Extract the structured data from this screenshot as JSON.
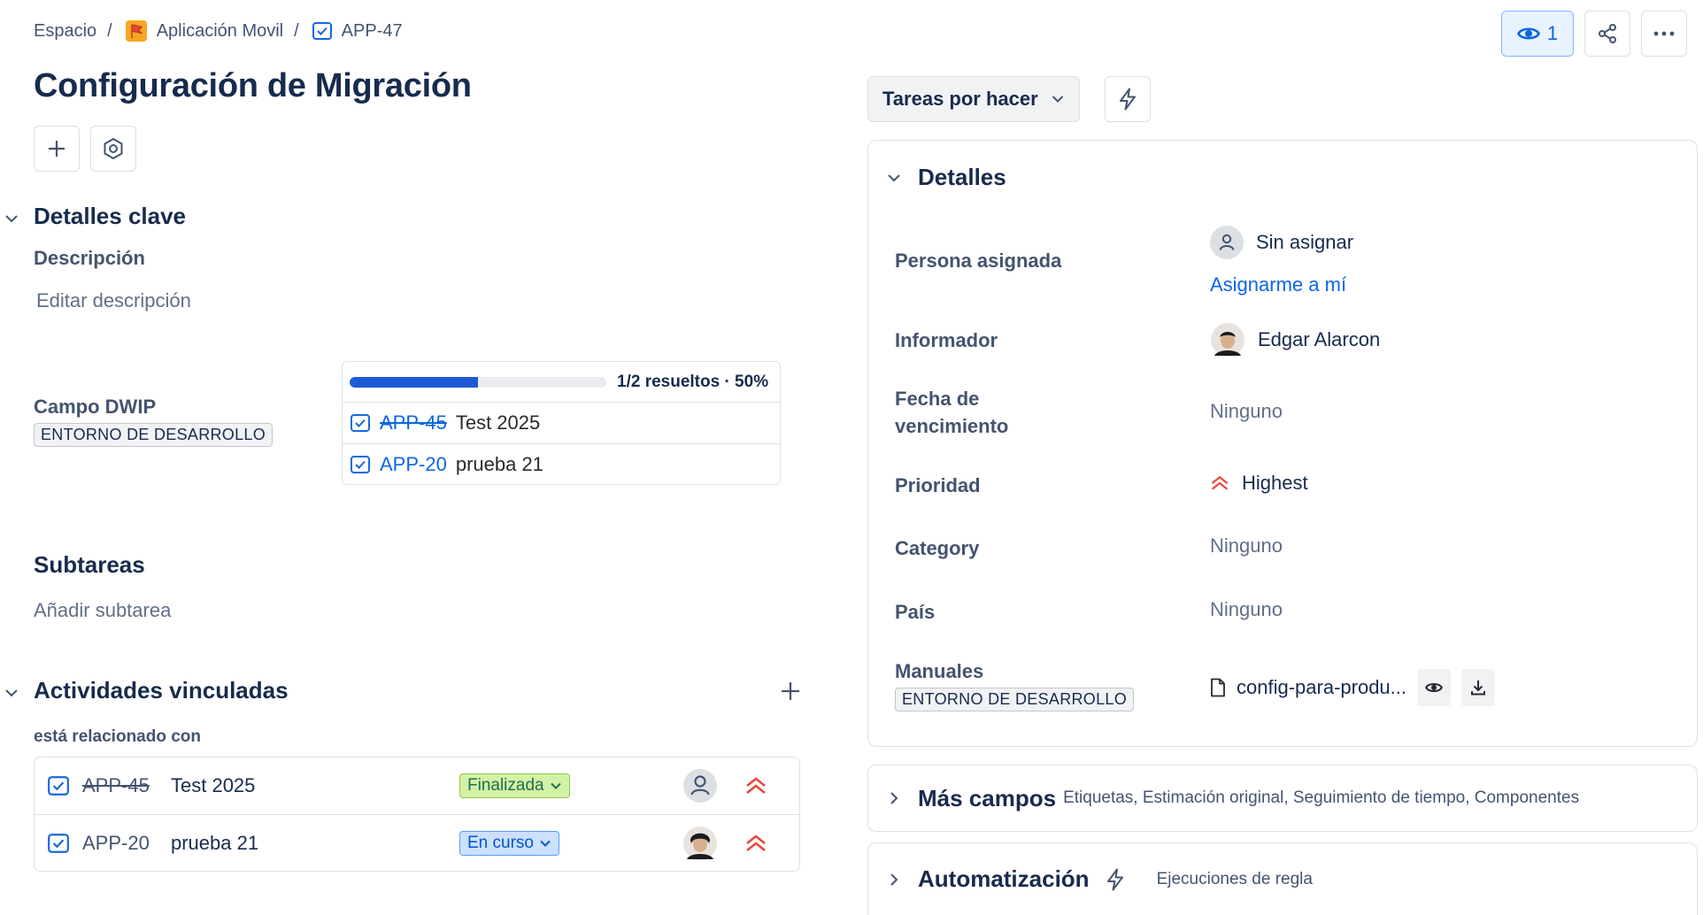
{
  "breadcrumb": {
    "space": "Espacio",
    "project": "Aplicación Movil",
    "issue_key": "APP-47",
    "separator": "/"
  },
  "header": {
    "watch_count": "1",
    "title": "Configuración de Migración"
  },
  "key_details": {
    "heading": "Detalles clave",
    "description_label": "Descripción",
    "description_placeholder": "Editar descripción",
    "dwip": {
      "label": "Campo DWIP",
      "environment": "ENTORNO DE DESARROLLO",
      "progress_text": "1/2 resueltos · 50%",
      "progress_fraction": 0.5,
      "items": [
        {
          "key": "APP-45",
          "summary": "Test 2025",
          "resolved": true
        },
        {
          "key": "APP-20",
          "summary": "prueba 21",
          "resolved": false
        }
      ]
    }
  },
  "subtasks": {
    "heading": "Subtareas",
    "add_label": "Añadir subtarea"
  },
  "linked": {
    "heading": "Actividades vinculadas",
    "relation": "está relacionado con",
    "items": [
      {
        "key": "APP-45",
        "summary": "Test 2025",
        "status": "Finalizada",
        "resolved": true
      },
      {
        "key": "APP-20",
        "summary": "prueba 21",
        "status": "En curso",
        "resolved": false
      }
    ]
  },
  "right": {
    "status_button": "Tareas por hacer",
    "details_heading": "Detalles",
    "fields": {
      "assignee_label": "Persona asignada",
      "assignee_value": "Sin asignar",
      "assign_me": "Asignarme a mí",
      "reporter_label": "Informador",
      "reporter_value": "Edgar Alarcon",
      "due_label_1": "Fecha de",
      "due_label_2": "vencimiento",
      "due_value": "Ninguno",
      "priority_label": "Prioridad",
      "priority_value": "Highest",
      "category_label": "Category",
      "category_value": "Ninguno",
      "country_label": "País",
      "country_value": "Ninguno",
      "manuals_label": "Manuales",
      "manuals_env": "ENTORNO DE DESARROLLO",
      "manuals_file": "config-para-produ..."
    },
    "more_fields": {
      "heading": "Más campos",
      "summary": "Etiquetas, Estimación original, Seguimiento de tiempo, Componentes"
    },
    "automation": {
      "heading": "Automatización",
      "summary": "Ejecuciones de regla"
    }
  },
  "colors": {
    "accent": "#0c66e4",
    "progress": "#1d5bd6",
    "priority_highest": "#e5493a",
    "project_icon": "#f5a623"
  }
}
